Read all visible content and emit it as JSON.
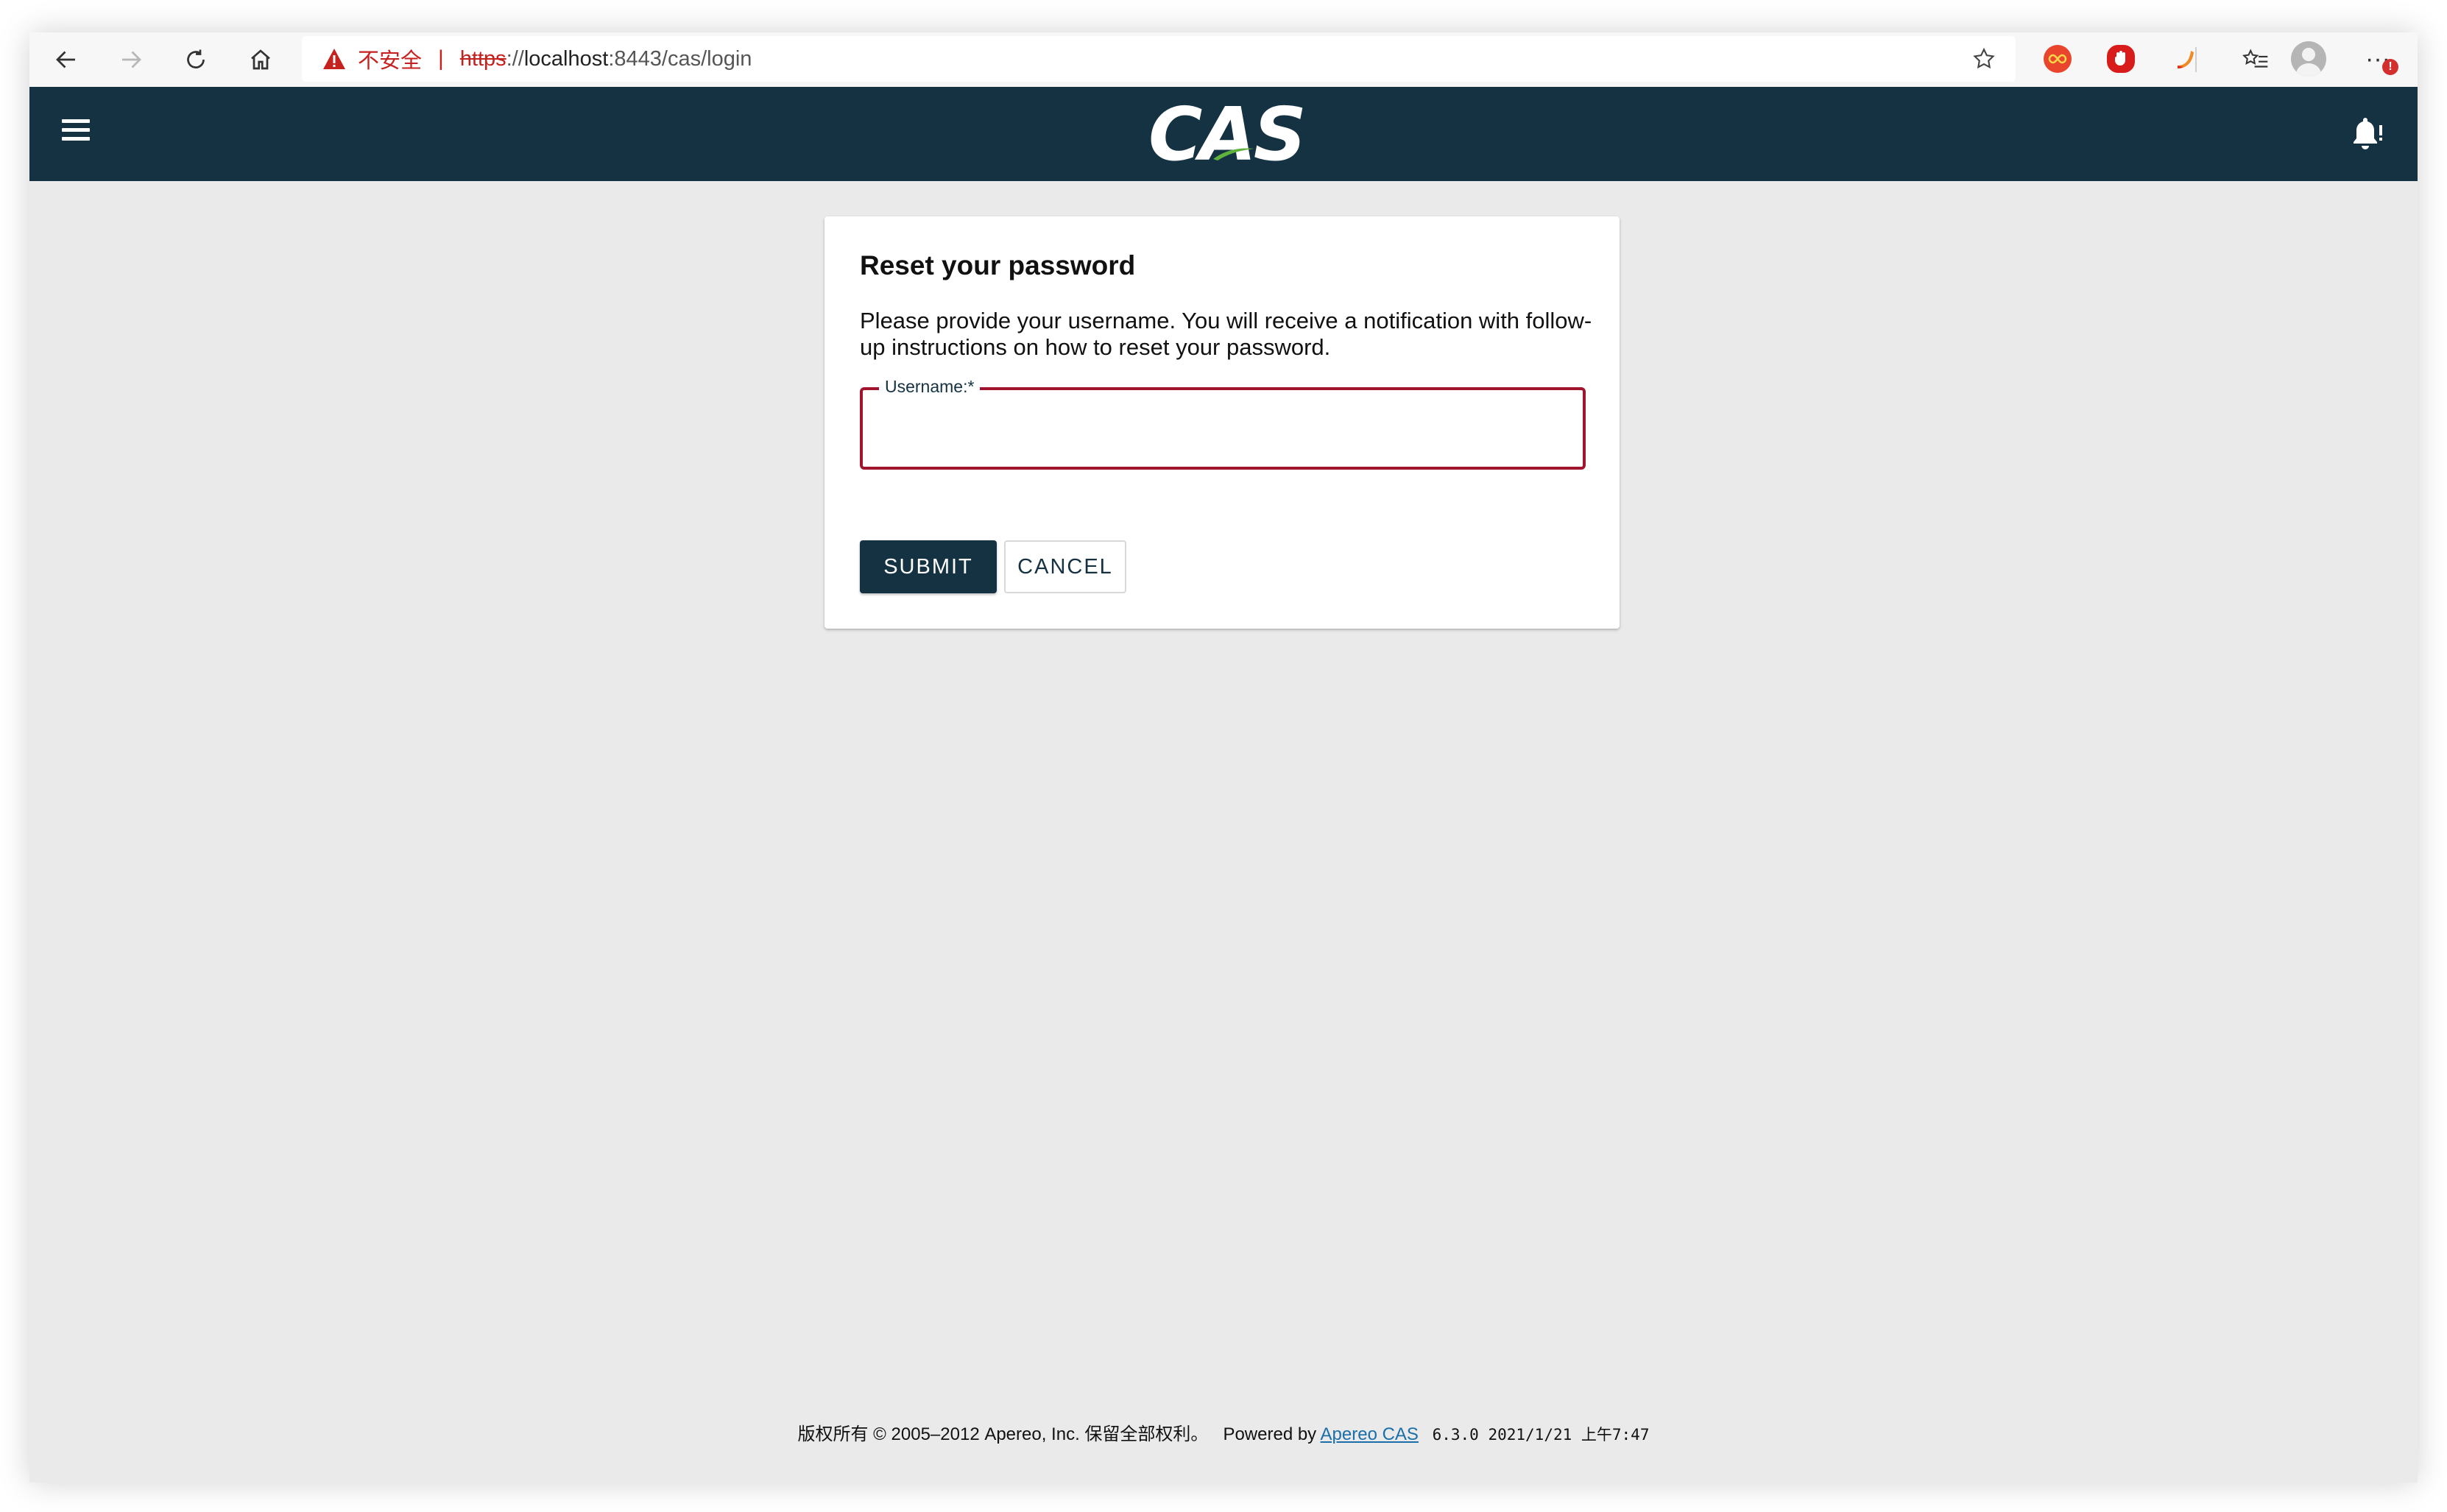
{
  "browser": {
    "security_label": "不安全",
    "url_scheme": "https",
    "url_separator": "://",
    "url_host": "localhost",
    "url_rest": ":8443/cas/login",
    "more_badge": "!",
    "icons": {
      "back": "arrow-left-icon",
      "forward": "arrow-right-icon",
      "reload": "reload-icon",
      "home": "home-icon",
      "favorite": "star-icon",
      "collections": "favorites-list-icon",
      "more": "more-icon"
    }
  },
  "header": {
    "logo_text": "CAS",
    "colors": {
      "background": "#153243",
      "logo_swoosh": "#5fb33b"
    }
  },
  "card": {
    "title": "Reset your password",
    "description": "Please provide your username. You will receive a notification with follow-up instructions on how to reset your password.",
    "username_label": "Username:*",
    "username_value": "",
    "submit_label": "SUBMIT",
    "cancel_label": "CANCEL",
    "colors": {
      "field_border": "#a0142e",
      "primary": "#153243"
    }
  },
  "footer": {
    "copyright": "版权所有 © 2005–2012 Apereo, Inc. 保留全部权利。",
    "powered_by": "Powered by",
    "link_text": "Apereo CAS",
    "version_info": "6.3.0 2021/1/21 上午7:47"
  }
}
